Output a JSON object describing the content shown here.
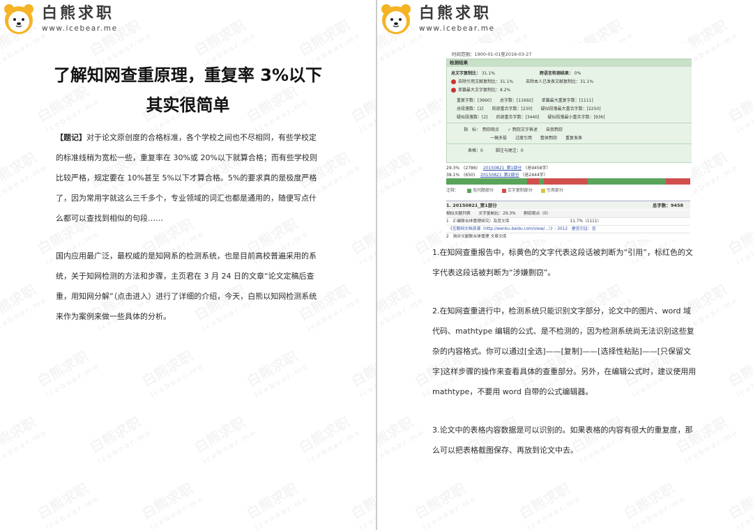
{
  "brand": {
    "name": "白熊求职",
    "url": "www.icebear.me",
    "watermark_name": "白熊求职",
    "watermark_url": "icebear.me"
  },
  "left": {
    "title_line1": "了解知网查重原理，重复率 3%以下",
    "title_line2": "其实很简单",
    "para1_tag": "【题记】",
    "para1": "对于论文原创度的合格标准，各个学校之间也不尽相同，有些学校定的标准线稍为宽松一些，重复率在 30%或 20%以下就算合格；而有些学校则比较严格，规定要在 10%甚至 5%以下才算合格。5%的要求真的是极度严格了，因为常用字就这么三千多个，专业领域的词汇也都是通用的，随便写点什么都可以查找到相似的句段……",
    "para2": "国内应用最广泛，最权威的是知网系的检测系统，也是目前高校普遍采用的系统，关于知网检测的方法和步骤，主页君在 3 月 24 日的文章“论文定稿后查重，用知网分解”（点击进入）进行了详细的介绍，今天，白熊以知网检测系统来作为案例来做一些具体的分析。"
  },
  "right": {
    "para1": "1.在知网查重报告中，标黄色的文字代表这段话被判断为“引用”，标红色的文字代表这段话被判断为“涉嫌剽窃”。",
    "para2": "2.在知网查重进行中，检测系统只能识别文字部分，论文中的图片、word 域代码、mathtype 编辑的公式、是不检测的，因为检测系统尚无法识别这些复杂的内容格式。你可以通过[全选]——[复制]——[选择性粘贴]——[只保留文字]这样步骤的操作来查看具体的查重部分。另外，在编辑公式时，建议使用用 mathtype，不要用 word 自带的公式编辑器。",
    "para3": "3.论文中的表格内容数据是可以识别的。如果表格的内容有很大的重复度，那么可以把表格截图保存、再放到论文中去。"
  },
  "report": {
    "date": "时间范围：1900-01-01至2016-03-27",
    "header": "检测结果",
    "total_label": "总文字复制比：",
    "total_value": "31.1%",
    "cross_label": "跨语言检测结果：",
    "cross_value": "0%",
    "line_a": "去除引用文献复制比：31.1%　　　去除本人已发表文献复制比：31.1%",
    "line_b": "单篇最大文字复制比：8.2%",
    "stats1": "重复字数：[3660]　　总字数：[11692]　　单篇最大重复字数：[1111]",
    "stats2": "总段落数：[2]　　前部重合字数：[230]　　疑似段落最大重合字数：[2250]",
    "stats3": "疑似段落数：[2]　　后部重合字数：[3440]　　疑似段落最小重合字数：[936]",
    "opts1": "指　标：　剽窃观点　　✓ 剽窃文字表述　　自我剽窃",
    "opts2": "一稿多投　　过度引用　　整体剽窃　　重复发表",
    "fig": "表格：0　　　脚注与尾注：0",
    "res1_pct": "29.3%　(2786)",
    "res1_link": "20150821_第1部分",
    "res1_note": "（总9458字）",
    "res2_pct": "38.1%　(650)",
    "res2_link": "20150821_第2部分",
    "res2_note": "（总2444字）",
    "legend_text": "注释：",
    "legend_a": "无问题部分",
    "legend_b": "文字复制部分",
    "legend_c": "引用部分",
    "section": "1. 20150821_第1部分",
    "section_total": "总字数：9458",
    "tbl_head": "相似文献列表　　文字复制比：29.3%　　剽窃观点（0）",
    "tbl_row1": "1　汇编联合体管理研究）及其文库　　　　　　　　　　　　　　　11.7%（1111）",
    "tbl_row2": "　《互联网文档资源（http://wenku.baidu.com/view/...）》- 2012　是否引证：否",
    "tbl_row3": "2　测评文献联合体管理 文章文库"
  },
  "colors": {
    "bar_green": "#5aa35a",
    "bar_red": "#d05050",
    "bar_yellow": "#e0c040",
    "report_bg": "#e8f3e8"
  }
}
